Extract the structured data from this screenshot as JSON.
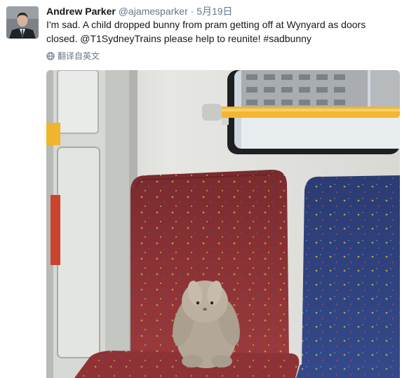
{
  "tweet": {
    "author_name": "Andrew Parker",
    "handle": "@ajamesparker",
    "separator": "·",
    "date": "5月19日",
    "text": "I'm sad. A child dropped bunny from pram getting off at Wynyard as doors closed. @T1SydneyTrains please help to reunite! #sadbunny",
    "translate_label": "翻译自英文"
  },
  "icons": {
    "avatar": "profile-photo",
    "translate": "globe-icon"
  },
  "colors": {
    "name": "#14171a",
    "meta": "#657786",
    "seat_red": "#8a2f33",
    "seat_blue": "#2d3f78",
    "handrail": "#f2b630"
  }
}
